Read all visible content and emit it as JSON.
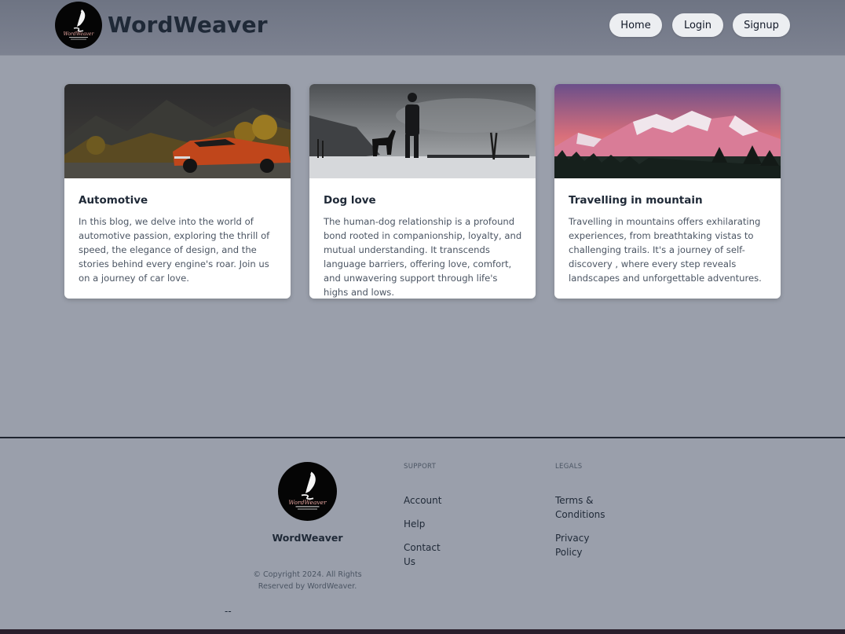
{
  "header": {
    "brand": "WordWeaver",
    "nav": {
      "home": "Home",
      "login": "Login",
      "signup": "Signup"
    }
  },
  "cards": [
    {
      "title": "Automotive",
      "text": "In this blog, we delve into the world of automotive passion, exploring the thrill of speed, the elegance of design, and the stories behind every engine's roar. Join us on a journey of car love.",
      "image_subject": "orange classic muscle car by autumn trees"
    },
    {
      "title": "Dog love",
      "text": "The human-dog relationship is a profound bond rooted in companionship, loyalty, and mutual understanding. It transcends language barriers, offering love, comfort, and unwavering support through life's highs and lows.",
      "image_subject": "person and dog silhouetted on snowy hill"
    },
    {
      "title": "Travelling in mountain",
      "text": "Travelling in mountains offers exhilarating experiences, from breathtaking vistas to challenging trails. It's a journey of self-discovery , where every step reveals landscapes and unforgettable adventures.",
      "image_subject": "snowy mountain range at pink sunset"
    }
  ],
  "footer": {
    "brand": "WordWeaver",
    "copyright": "© Copyright 2024. All Rights Reserved by WordWeaver.",
    "support": {
      "heading": "SUPPORT",
      "links": [
        "Account",
        "Help",
        "Contact Us"
      ]
    },
    "legals": {
      "heading": "LEGALS",
      "links": [
        "Terms & Conditions",
        "Privacy Policy"
      ]
    },
    "trailing_text": "--"
  },
  "colors": {
    "header_bg": "#737887",
    "page_bg": "#9a9fab",
    "card_bg": "#ffffff",
    "nav_button_bg": "#eceef1"
  },
  "logo_text": "WordWeaver"
}
